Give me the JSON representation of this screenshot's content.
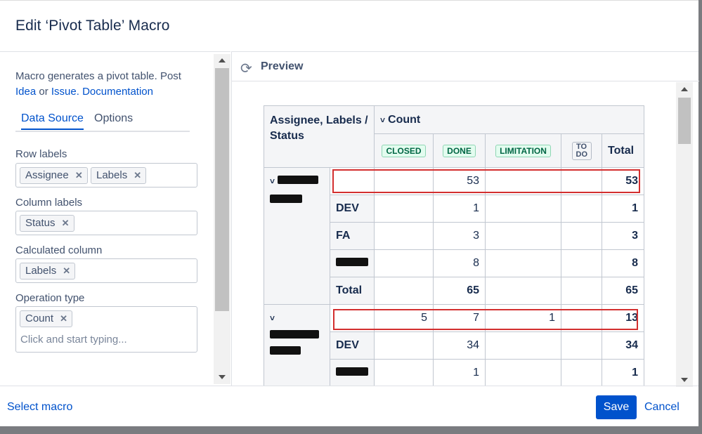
{
  "dialog": {
    "title": "Edit ‘Pivot Table’ Macro"
  },
  "description": {
    "text": "Macro generates a pivot table. Post",
    "link_idea": "Idea",
    "or": "or",
    "link_issue": "Issue.",
    "link_docs": "Documentation"
  },
  "tabs": [
    {
      "label": "Data Source"
    },
    {
      "label": "Options"
    }
  ],
  "fields": {
    "row_labels": {
      "label": "Row labels",
      "chips": [
        "Assignee",
        "Labels"
      ]
    },
    "column_labels": {
      "label": "Column labels",
      "chips": [
        "Status"
      ]
    },
    "calculated_column": {
      "label": "Calculated column",
      "chips": [
        "Labels"
      ]
    },
    "operation_type": {
      "label": "Operation type",
      "chips": [
        "Count"
      ],
      "placeholder": "Click and start typing..."
    }
  },
  "preview": {
    "label": "Preview"
  },
  "pivot": {
    "corner_header": "Assignee, Labels / Status",
    "count_header": "Count",
    "statuses": [
      "CLOSED",
      "DONE",
      "LIMITATION",
      "TO DO"
    ],
    "total_header": "Total",
    "group1": {
      "header_row": [
        "",
        "",
        "53",
        "",
        "",
        "53"
      ],
      "rows": [
        {
          "label": "DEV",
          "values": [
            "",
            "1",
            "",
            "",
            "1"
          ]
        },
        {
          "label": "FA",
          "values": [
            "",
            "3",
            "",
            "",
            "3"
          ]
        },
        {
          "label": "",
          "values": [
            "",
            "8",
            "",
            "",
            "8"
          ]
        }
      ],
      "total_row": {
        "label": "Total",
        "values": [
          "",
          "65",
          "",
          "",
          "65"
        ]
      }
    },
    "group2": {
      "header_row": [
        "",
        "5",
        "7",
        "1",
        "",
        "13"
      ],
      "rows": [
        {
          "label": "DEV",
          "values": [
            "",
            "34",
            "",
            "",
            "34"
          ]
        },
        {
          "label": "",
          "values": [
            "",
            "1",
            "",
            "",
            "1"
          ]
        }
      ]
    }
  },
  "footer": {
    "select_macro": "Select macro",
    "save": "Save",
    "cancel": "Cancel"
  },
  "colors": {
    "primary": "#0052cc",
    "highlight": "#d32f2f",
    "lozenge_green": "#006644"
  }
}
